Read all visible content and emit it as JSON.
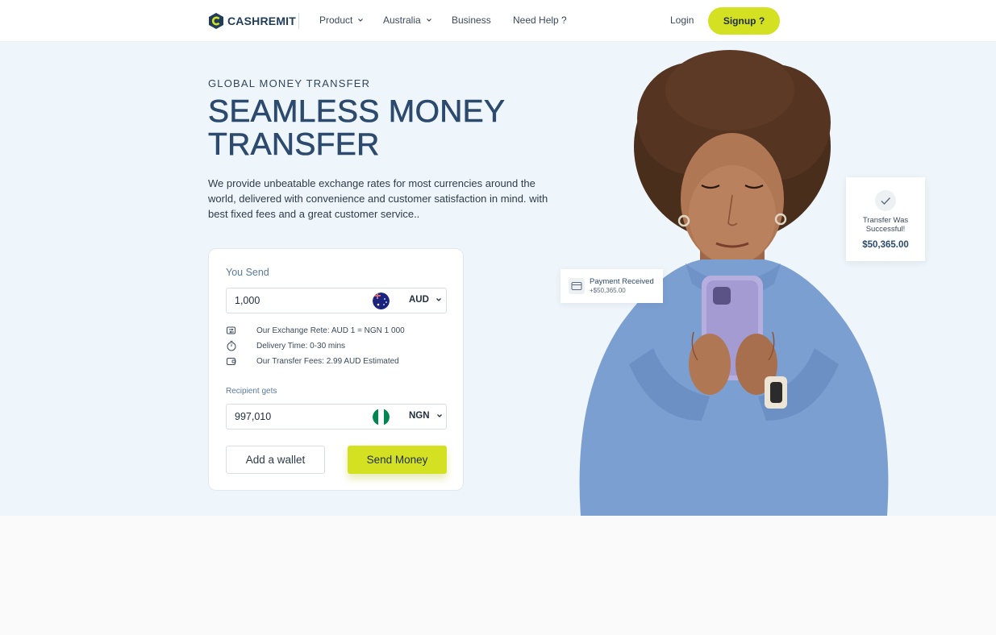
{
  "header": {
    "brand": "CASHREMIT",
    "nav": [
      {
        "label": "Product",
        "has_dropdown": true
      },
      {
        "label": "Australia",
        "has_dropdown": true
      },
      {
        "label": "Business",
        "has_dropdown": false
      },
      {
        "label": "Need Help ?",
        "has_dropdown": false
      }
    ],
    "login_label": "Login",
    "signup_label": "Signup ?"
  },
  "hero": {
    "eyebrow": "GLOBAL MONEY TRANSFER",
    "headline": "SEAMLESS MONEY TRANSFER",
    "description": "We provide unbeatable exchange rates for most currencies around the world, delivered with convenience and customer satisfaction in mind. with best fixed fees and a great customer service.."
  },
  "transfer_card": {
    "you_send_label": "You Send",
    "send_amount": "1,000",
    "send_currency": "AUD",
    "send_flag_icon": "australia-flag-icon",
    "info": [
      {
        "icon": "exchange-icon",
        "text": "Our Exchange Rete: AUD 1 = NGN 1 000"
      },
      {
        "icon": "timer-icon",
        "text": "Delivery Time: 0-30 mins"
      },
      {
        "icon": "wallet-icon",
        "text": "Our Transfer Fees: 2.99 AUD Estimated"
      }
    ],
    "recipient_label": "Recipient gets",
    "receive_amount": "997,010",
    "receive_currency": "NGN",
    "receive_flag_icon": "nigeria-flag-icon",
    "add_wallet_label": "Add a wallet",
    "send_money_label": "Send Money"
  },
  "notifications": {
    "payment": {
      "title": "Payment Received",
      "amount": "+$50,365.00"
    },
    "success": {
      "title": "Transfer Was Successful!",
      "amount": "$50,365.00"
    }
  },
  "colors": {
    "accent": "#d4e022",
    "brand": "#1f3c5a",
    "headline": "#2c4a6e",
    "hero_bg": "#eef5fb"
  }
}
